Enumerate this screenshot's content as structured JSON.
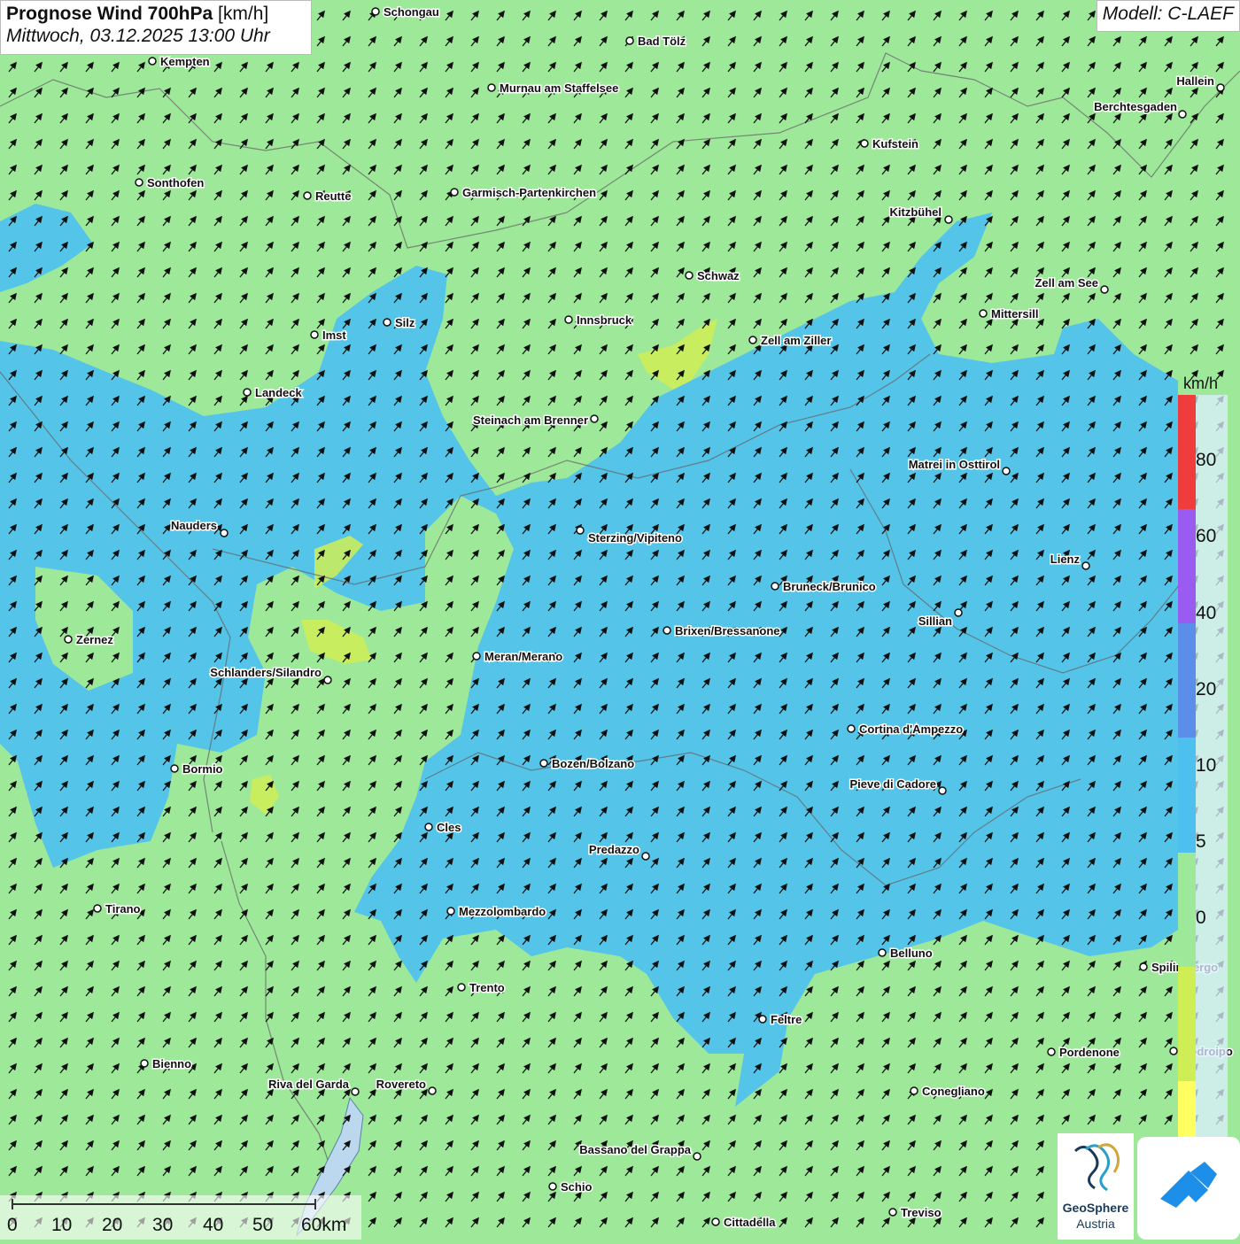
{
  "header": {
    "title_bold": "Prognose Wind 700hPa",
    "title_unit": "[km/h]",
    "datetime": "Mittwoch, 03.12.2025 13:00 Uhr",
    "model": "Modell: C-LAEF"
  },
  "colors": {
    "calm": "#ffff60",
    "low": "#cfee55",
    "moderate": "#9ee89a",
    "fresh": "#4ec0f0",
    "strong": "#5b8ee8",
    "very_strong": "#9a5cf0",
    "extreme": "#f03c3c",
    "arrow": "#111111",
    "border": "#666666"
  },
  "legend": {
    "unit": "km/h",
    "ticks": [
      "80",
      "60",
      "40",
      "20",
      "10",
      "5",
      "0"
    ],
    "colors": [
      "#f03c3c",
      "#9a5cf0",
      "#5b8ee8",
      "#4ec0f0",
      "#9ee89a",
      "#cfee55",
      "#ffff60"
    ]
  },
  "scalebar": {
    "labels": [
      "0",
      "10",
      "20",
      "30",
      "40",
      "50",
      "60km"
    ]
  },
  "logos": {
    "geosphere_name": "GeoSphere",
    "geosphere_sub": "Austria",
    "geosphere_icon": "geosphere-swirl-icon",
    "app_icon": "weather-app-icon"
  },
  "map": {
    "wind_direction": "southwest",
    "cities": [
      {
        "name": "Schongau"
      },
      {
        "name": "Bad Tölz"
      },
      {
        "name": "Kempten"
      },
      {
        "name": "Murnau am Staffelsee"
      },
      {
        "name": "Hallein"
      },
      {
        "name": "Berchtesgaden"
      },
      {
        "name": "Kufstein"
      },
      {
        "name": "Sonthofen"
      },
      {
        "name": "Reutte"
      },
      {
        "name": "Garmisch-Partenkirchen"
      },
      {
        "name": "Kitzbühel"
      },
      {
        "name": "Schwaz"
      },
      {
        "name": "Zell am See"
      },
      {
        "name": "Mittersill"
      },
      {
        "name": "Silz"
      },
      {
        "name": "Innsbruck"
      },
      {
        "name": "Imst"
      },
      {
        "name": "Zell am Ziller"
      },
      {
        "name": "Landeck"
      },
      {
        "name": "Steinach am Brenner"
      },
      {
        "name": "Matrei in Osttirol"
      },
      {
        "name": "Nauders"
      },
      {
        "name": "Sterzing/Vipiteno"
      },
      {
        "name": "Lienz"
      },
      {
        "name": "Bruneck/Brunico"
      },
      {
        "name": "Sillian"
      },
      {
        "name": "Zernez"
      },
      {
        "name": "Brixen/Bressanone"
      },
      {
        "name": "Meran/Merano"
      },
      {
        "name": "Schlanders/Silandro"
      },
      {
        "name": "Cortina d'Ampezzo"
      },
      {
        "name": "Bozen/Bolzano"
      },
      {
        "name": "Bormio"
      },
      {
        "name": "Pieve di Cadore"
      },
      {
        "name": "Cles"
      },
      {
        "name": "Predazzo"
      },
      {
        "name": "Tirano"
      },
      {
        "name": "Mezzolombardo"
      },
      {
        "name": "Belluno"
      },
      {
        "name": "Spilimbergo"
      },
      {
        "name": "Trento"
      },
      {
        "name": "Feltre"
      },
      {
        "name": "Pordenone"
      },
      {
        "name": "Codroipo"
      },
      {
        "name": "Bienno"
      },
      {
        "name": "Riva del Garda"
      },
      {
        "name": "Rovereto"
      },
      {
        "name": "Conegliano"
      },
      {
        "name": "Bassano del Grappa"
      },
      {
        "name": "Schio"
      },
      {
        "name": "Treviso"
      },
      {
        "name": "Cittadella"
      }
    ]
  }
}
